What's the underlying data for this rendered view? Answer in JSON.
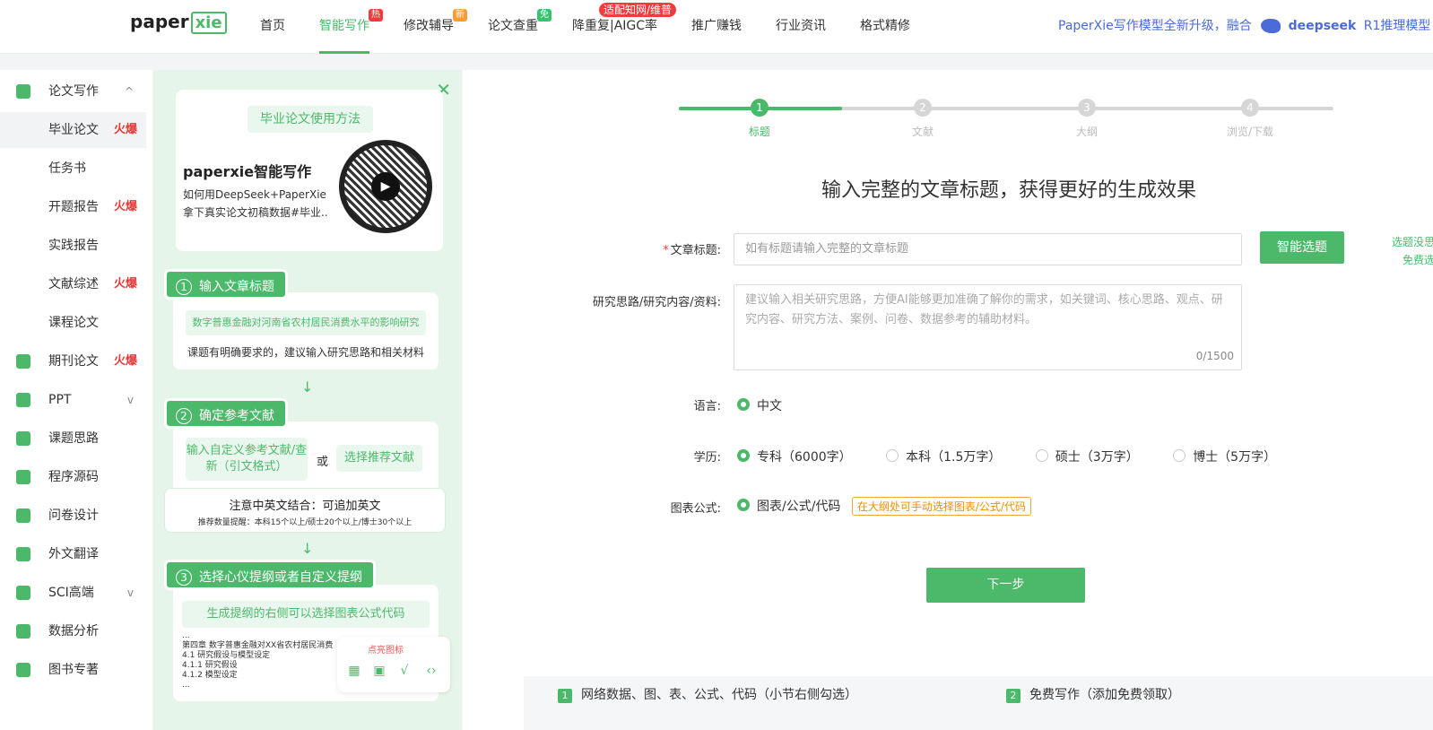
{
  "header": {
    "logo_text": "paper",
    "logo_x": "xie",
    "nav": [
      {
        "label": "首页",
        "badge": ""
      },
      {
        "label": "智能写作",
        "badge": "热"
      },
      {
        "label": "修改辅导",
        "badge": "新"
      },
      {
        "label": "论文查重",
        "badge": "免"
      },
      {
        "label": "降重复|AIGC率",
        "badge": "适配知网/维普"
      },
      {
        "label": "推广赚钱",
        "badge": ""
      },
      {
        "label": "行业资讯",
        "badge": ""
      },
      {
        "label": "格式精修",
        "badge": ""
      }
    ],
    "promo_text": "PaperXie写作模型全新升级，融合",
    "promo_brand": "deepseek",
    "promo_suffix": "R1推理模型"
  },
  "sidebar": {
    "items": [
      {
        "label": "论文写作",
        "hot": "",
        "chevron": "^"
      },
      {
        "label": "毕业论文",
        "hot": "火爆"
      },
      {
        "label": "任务书",
        "hot": ""
      },
      {
        "label": "开题报告",
        "hot": "火爆"
      },
      {
        "label": "实践报告",
        "hot": ""
      },
      {
        "label": "文献综述",
        "hot": "火爆"
      },
      {
        "label": "课程论文",
        "hot": ""
      },
      {
        "label": "期刊论文",
        "hot": "火爆"
      },
      {
        "label": "PPT",
        "hot": "",
        "chevron": "v"
      },
      {
        "label": "课题思路",
        "hot": ""
      },
      {
        "label": "程序源码",
        "hot": ""
      },
      {
        "label": "问卷设计",
        "hot": ""
      },
      {
        "label": "外文翻译",
        "hot": ""
      },
      {
        "label": "SCI高端",
        "hot": "",
        "chevron": "v"
      },
      {
        "label": "数据分析",
        "hot": ""
      },
      {
        "label": "图书专著",
        "hot": ""
      }
    ]
  },
  "guide": {
    "usage_title": "毕业论文使用方法",
    "video_title": "paperxie智能写作",
    "video_desc_1": "如何用DeepSeek+PaperXie",
    "video_desc_2": "拿下真实论文初稿数据#毕业..",
    "step1": {
      "num": "1",
      "title": "输入文章标题",
      "example": "数字普惠金融对河南省农村居民消费水平的影响研究",
      "hint": "课题有明确要求的，建议输入研究思路和相关材料"
    },
    "step2": {
      "num": "2",
      "title": "确定参考文献",
      "option1": "输入自定义参考文献/查新（引文格式）",
      "or": "或",
      "option2": "选择推荐文献"
    },
    "tip_title": "注意中英文结合：可追加英文",
    "tip_sub": "推荐数量提醒：本科15个以上/硕士20个以上/博士30个以上",
    "step3": {
      "num": "3",
      "title": "选择心仪提纲或者自定义提纲",
      "pill": "生成提纲的右侧可以选择图表公式代码",
      "outline": [
        "...",
        "第四章 数字普惠金融对XX省农村居民消费",
        "4.1 研究假设与模型设定",
        "4.1.1 研究假设",
        "4.1.2 模型设定",
        "..."
      ],
      "highlight": "点亮图标"
    }
  },
  "stepper": {
    "steps": [
      {
        "num": "1",
        "label": "标题"
      },
      {
        "num": "2",
        "label": "文献"
      },
      {
        "num": "3",
        "label": "大纲"
      },
      {
        "num": "4",
        "label": "浏览/下载"
      }
    ]
  },
  "form": {
    "heading": "输入完整的文章标题，获得更好的生成效果",
    "title_label": "文章标题:",
    "title_placeholder": "如有标题请输入完整的文章标题",
    "smart_button": "智能选题",
    "side_note_1": "选题没思",
    "side_note_2": "免费选",
    "idea_label": "研究思路/研究内容/资料:",
    "idea_placeholder": "建议输入相关研究思路，方便AI能够更加准确了解你的需求，如关键词、核心思路、观点、研究内容、研究方法、案例、问卷、数据参考的辅助材料。",
    "counter": "0/1500",
    "lang_label": "语言:",
    "lang_option": "中文",
    "degree_label": "学历:",
    "degrees": [
      "专科（6000字）",
      "本科（1.5万字）",
      "硕士（3万字）",
      "博士（5万字）"
    ],
    "chart_label": "图表公式:",
    "chart_option": "图表/公式/代码",
    "chart_note": "在大纲处可手动选择图表/公式/代码",
    "next_button": "下一步"
  },
  "bottom": {
    "item1_num": "1",
    "item1": "网络数据、图、表、公式、代码（小节右侧勾选）",
    "item2_num": "2",
    "item2": "免费写作（添加免费领取）"
  }
}
